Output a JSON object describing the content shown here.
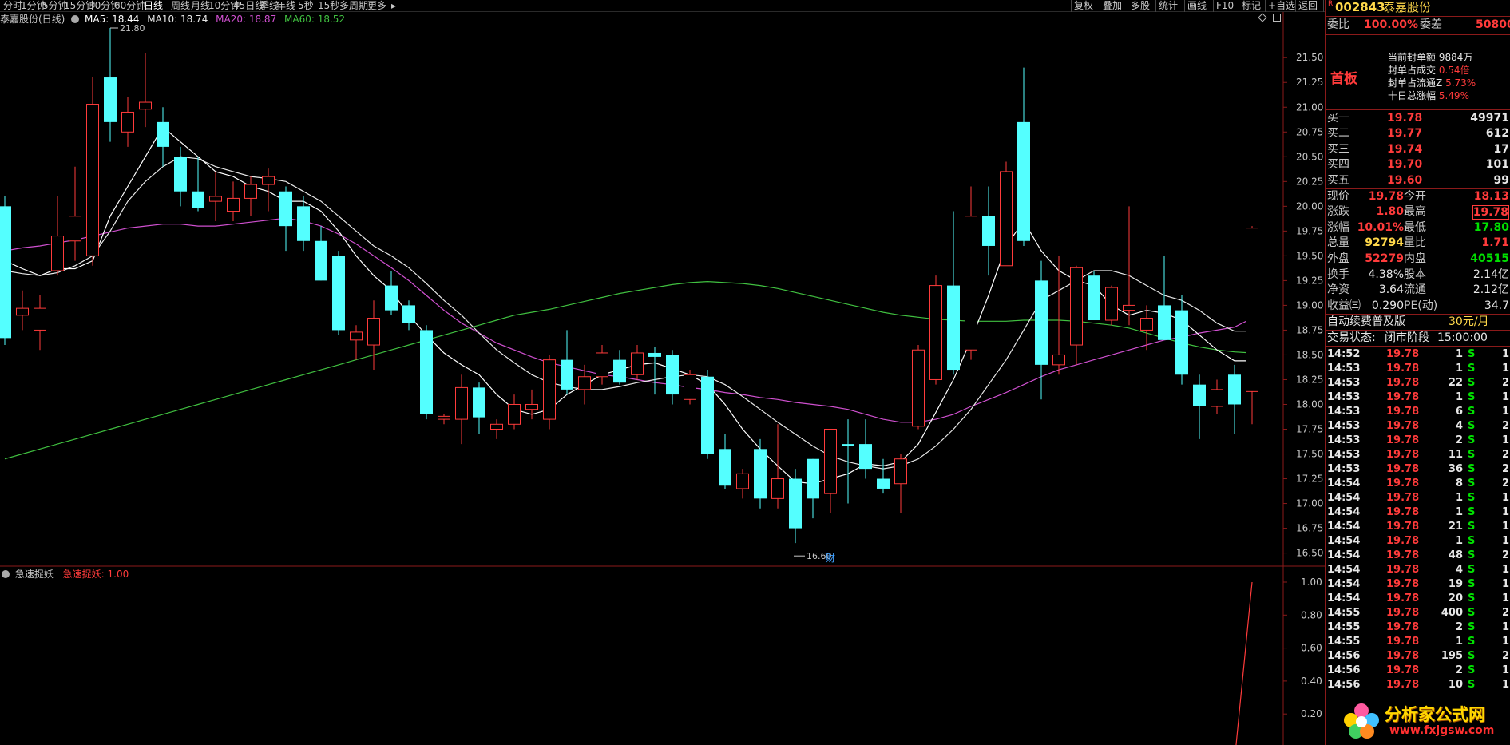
{
  "toolbar": {
    "periods": [
      "分时",
      "1分钟",
      "5分钟",
      "15分钟",
      "30分钟",
      "60分钟",
      "日线",
      "周线",
      "月线",
      "10分钟",
      "45日线",
      "季线",
      "年线",
      "5秒",
      "15秒",
      "多周期",
      "更多"
    ],
    "active_period": "日线",
    "right_buttons": [
      "复权",
      "叠加",
      "多股",
      "统计",
      "画线",
      "F10",
      "标记",
      "+自选",
      "返回"
    ]
  },
  "main_chart": {
    "title": "泰嘉股份(日线)",
    "ma": [
      {
        "label": "MA5: 18.44",
        "color": "#ffffff"
      },
      {
        "label": "MA10: 18.74",
        "color": "#e8e8e8"
      },
      {
        "label": "MA20: 18.87",
        "color": "#d050d0"
      },
      {
        "label": "MA60: 18.52",
        "color": "#40c040"
      }
    ],
    "high_label": "21.80",
    "low_label": "16.60",
    "event_marker": "财",
    "ylim": [
      16.4,
      21.8
    ],
    "yticks": [
      "21.50",
      "21.25",
      "21.00",
      "20.75",
      "20.50",
      "20.25",
      "20.00",
      "19.75",
      "19.50",
      "19.25",
      "19.00",
      "18.75",
      "18.50",
      "18.25",
      "18.00",
      "17.75",
      "17.50",
      "17.25",
      "17.00",
      "16.75",
      "16.50"
    ]
  },
  "chart_data": {
    "type": "candlestick",
    "up_color": "#ff3b3b",
    "down_color": "#54ffff",
    "ma_colors": {
      "MA5": "#ffffff",
      "MA10": "#e8e8e8",
      "MA20": "#d050d0",
      "MA60": "#40c040"
    },
    "candles": [
      {
        "o": 20.0,
        "h": 20.1,
        "l": 18.6,
        "c": 18.67
      },
      {
        "o": 18.9,
        "h": 19.15,
        "l": 18.75,
        "c": 18.97
      },
      {
        "o": 18.75,
        "h": 19.1,
        "l": 18.55,
        "c": 18.97
      },
      {
        "o": 19.35,
        "h": 20.1,
        "l": 19.3,
        "c": 19.7
      },
      {
        "o": 19.65,
        "h": 20.4,
        "l": 19.45,
        "c": 19.9
      },
      {
        "o": 19.5,
        "h": 21.3,
        "l": 19.4,
        "c": 21.03
      },
      {
        "o": 21.3,
        "h": 21.8,
        "l": 20.65,
        "c": 20.85
      },
      {
        "o": 20.75,
        "h": 21.1,
        "l": 20.6,
        "c": 20.95
      },
      {
        "o": 20.98,
        "h": 21.55,
        "l": 20.8,
        "c": 21.05
      },
      {
        "o": 20.85,
        "h": 21.0,
        "l": 20.4,
        "c": 20.6
      },
      {
        "o": 20.5,
        "h": 20.6,
        "l": 20.0,
        "c": 20.15
      },
      {
        "o": 20.15,
        "h": 20.5,
        "l": 19.95,
        "c": 19.98
      },
      {
        "o": 20.05,
        "h": 20.35,
        "l": 19.85,
        "c": 20.1
      },
      {
        "o": 19.95,
        "h": 20.25,
        "l": 19.85,
        "c": 20.08
      },
      {
        "o": 20.08,
        "h": 20.3,
        "l": 19.9,
        "c": 20.22
      },
      {
        "o": 20.22,
        "h": 20.38,
        "l": 19.95,
        "c": 20.3
      },
      {
        "o": 20.15,
        "h": 20.2,
        "l": 19.55,
        "c": 19.8
      },
      {
        "o": 20.0,
        "h": 20.1,
        "l": 19.55,
        "c": 19.65
      },
      {
        "o": 19.65,
        "h": 19.8,
        "l": 19.25,
        "c": 19.25
      },
      {
        "o": 19.5,
        "h": 19.55,
        "l": 18.7,
        "c": 18.75
      },
      {
        "o": 18.65,
        "h": 18.8,
        "l": 18.45,
        "c": 18.73
      },
      {
        "o": 18.6,
        "h": 19.05,
        "l": 18.35,
        "c": 18.87
      },
      {
        "o": 19.2,
        "h": 19.35,
        "l": 18.9,
        "c": 18.95
      },
      {
        "o": 19.0,
        "h": 19.05,
        "l": 18.75,
        "c": 18.82
      },
      {
        "o": 18.75,
        "h": 18.8,
        "l": 17.85,
        "c": 17.9
      },
      {
        "o": 17.85,
        "h": 17.9,
        "l": 17.8,
        "c": 17.88
      },
      {
        "o": 17.85,
        "h": 18.3,
        "l": 17.6,
        "c": 18.17
      },
      {
        "o": 18.17,
        "h": 18.22,
        "l": 17.7,
        "c": 17.87
      },
      {
        "o": 17.75,
        "h": 17.85,
        "l": 17.65,
        "c": 17.8
      },
      {
        "o": 17.8,
        "h": 18.1,
        "l": 17.75,
        "c": 18.0
      },
      {
        "o": 17.95,
        "h": 18.15,
        "l": 17.85,
        "c": 18.0
      },
      {
        "o": 17.85,
        "h": 18.5,
        "l": 17.75,
        "c": 18.45
      },
      {
        "o": 18.45,
        "h": 18.75,
        "l": 18.1,
        "c": 18.15
      },
      {
        "o": 18.15,
        "h": 18.4,
        "l": 18.0,
        "c": 18.28
      },
      {
        "o": 18.28,
        "h": 18.6,
        "l": 18.2,
        "c": 18.52
      },
      {
        "o": 18.45,
        "h": 18.55,
        "l": 18.2,
        "c": 18.22
      },
      {
        "o": 18.3,
        "h": 18.6,
        "l": 18.25,
        "c": 18.52
      },
      {
        "o": 18.52,
        "h": 18.58,
        "l": 18.1,
        "c": 18.48
      },
      {
        "o": 18.5,
        "h": 18.55,
        "l": 18.0,
        "c": 18.1
      },
      {
        "o": 18.05,
        "h": 18.35,
        "l": 18.0,
        "c": 18.3
      },
      {
        "o": 18.28,
        "h": 18.35,
        "l": 17.45,
        "c": 17.5
      },
      {
        "o": 17.55,
        "h": 17.7,
        "l": 17.15,
        "c": 17.18
      },
      {
        "o": 17.15,
        "h": 17.35,
        "l": 17.05,
        "c": 17.3
      },
      {
        "o": 17.55,
        "h": 17.65,
        "l": 16.95,
        "c": 17.05
      },
      {
        "o": 17.05,
        "h": 17.8,
        "l": 16.95,
        "c": 17.25
      },
      {
        "o": 17.25,
        "h": 17.35,
        "l": 16.6,
        "c": 16.75
      },
      {
        "o": 17.45,
        "h": 17.45,
        "l": 16.85,
        "c": 17.05
      },
      {
        "o": 17.1,
        "h": 17.75,
        "l": 16.9,
        "c": 17.75
      },
      {
        "o": 17.6,
        "h": 17.85,
        "l": 17.0,
        "c": 17.58
      },
      {
        "o": 17.6,
        "h": 17.85,
        "l": 17.25,
        "c": 17.35
      },
      {
        "o": 17.25,
        "h": 17.45,
        "l": 17.1,
        "c": 17.15
      },
      {
        "o": 17.2,
        "h": 17.5,
        "l": 16.9,
        "c": 17.45
      },
      {
        "o": 17.78,
        "h": 18.6,
        "l": 17.75,
        "c": 18.55
      },
      {
        "o": 18.25,
        "h": 19.3,
        "l": 18.2,
        "c": 19.2
      },
      {
        "o": 19.2,
        "h": 19.95,
        "l": 18.3,
        "c": 18.35
      },
      {
        "o": 18.55,
        "h": 20.2,
        "l": 18.45,
        "c": 19.9
      },
      {
        "o": 19.9,
        "h": 20.2,
        "l": 19.3,
        "c": 19.6
      },
      {
        "o": 19.4,
        "h": 20.45,
        "l": 19.4,
        "c": 20.35
      },
      {
        "o": 20.85,
        "h": 21.4,
        "l": 19.6,
        "c": 19.65
      },
      {
        "o": 19.25,
        "h": 19.45,
        "l": 18.05,
        "c": 18.4
      },
      {
        "o": 18.4,
        "h": 19.5,
        "l": 18.3,
        "c": 18.5
      },
      {
        "o": 18.6,
        "h": 19.4,
        "l": 18.4,
        "c": 19.38
      },
      {
        "o": 19.3,
        "h": 19.35,
        "l": 18.85,
        "c": 18.85
      },
      {
        "o": 18.85,
        "h": 19.2,
        "l": 18.8,
        "c": 19.18
      },
      {
        "o": 18.95,
        "h": 20.0,
        "l": 18.8,
        "c": 19.0
      },
      {
        "o": 18.75,
        "h": 19.0,
        "l": 18.55,
        "c": 18.87
      },
      {
        "o": 19.0,
        "h": 19.5,
        "l": 18.65,
        "c": 18.65
      },
      {
        "o": 18.95,
        "h": 19.1,
        "l": 18.2,
        "c": 18.3
      },
      {
        "o": 18.2,
        "h": 18.3,
        "l": 17.65,
        "c": 17.98
      },
      {
        "o": 17.98,
        "h": 18.25,
        "l": 17.9,
        "c": 18.15
      },
      {
        "o": 18.3,
        "h": 18.4,
        "l": 17.7,
        "c": 18.0
      },
      {
        "o": 18.13,
        "h": 19.8,
        "l": 17.8,
        "c": 19.78
      }
    ],
    "ma5": [
      19.45,
      19.37,
      19.3,
      19.37,
      19.37,
      19.45,
      19.9,
      20.2,
      20.5,
      20.8,
      20.65,
      20.5,
      20.35,
      20.3,
      20.2,
      20.15,
      20.05,
      20.05,
      19.95,
      19.75,
      19.5,
      19.3,
      19.15,
      18.9,
      18.7,
      18.52,
      18.4,
      18.3,
      18.1,
      17.95,
      17.9,
      17.95,
      18.1,
      18.2,
      18.3,
      18.35,
      18.4,
      18.42,
      18.36,
      18.3,
      18.2,
      18.0,
      17.75,
      17.55,
      17.38,
      17.22,
      17.2,
      17.25,
      17.3,
      17.4,
      17.38,
      17.42,
      17.6,
      17.92,
      18.25,
      18.65,
      19.1,
      19.6,
      19.85,
      19.55,
      19.35,
      19.25,
      19.2,
      19.0,
      18.9,
      18.95,
      18.92,
      18.85,
      18.7,
      18.55,
      18.44,
      18.44
    ],
    "ma10": [
      19.35,
      19.32,
      19.3,
      19.33,
      19.4,
      19.5,
      19.75,
      20.05,
      20.25,
      20.4,
      20.5,
      20.48,
      20.4,
      20.35,
      20.3,
      20.28,
      20.25,
      20.15,
      20.05,
      19.9,
      19.75,
      19.6,
      19.5,
      19.38,
      19.22,
      19.05,
      18.9,
      18.72,
      18.55,
      18.42,
      18.3,
      18.22,
      18.18,
      18.15,
      18.15,
      18.18,
      18.22,
      18.25,
      18.28,
      18.3,
      18.28,
      18.2,
      18.08,
      17.95,
      17.82,
      17.7,
      17.58,
      17.48,
      17.42,
      17.38,
      17.35,
      17.38,
      17.45,
      17.58,
      17.75,
      17.95,
      18.2,
      18.45,
      18.75,
      19.05,
      19.15,
      19.25,
      19.35,
      19.35,
      19.3,
      19.2,
      19.1,
      19.05,
      18.95,
      18.82,
      18.74,
      18.74
    ],
    "ma20": [
      19.55,
      19.58,
      19.6,
      19.63,
      19.66,
      19.7,
      19.74,
      19.78,
      19.8,
      19.82,
      19.82,
      19.8,
      19.8,
      19.82,
      19.84,
      19.86,
      19.88,
      19.85,
      19.8,
      19.72,
      19.62,
      19.5,
      19.38,
      19.25,
      19.1,
      18.95,
      18.82,
      18.72,
      18.62,
      18.55,
      18.48,
      18.42,
      18.38,
      18.34,
      18.3,
      18.28,
      18.25,
      18.22,
      18.2,
      18.17,
      18.15,
      18.12,
      18.1,
      18.07,
      18.05,
      18.02,
      18.0,
      17.98,
      17.95,
      17.9,
      17.85,
      17.82,
      17.82,
      17.85,
      17.9,
      17.98,
      18.05,
      18.12,
      18.2,
      18.28,
      18.35,
      18.4,
      18.45,
      18.5,
      18.55,
      18.6,
      18.65,
      18.68,
      18.72,
      18.75,
      18.78,
      18.87
    ],
    "ma60": [
      17.45,
      17.5,
      17.55,
      17.6,
      17.65,
      17.7,
      17.75,
      17.8,
      17.85,
      17.9,
      17.95,
      18.0,
      18.05,
      18.1,
      18.15,
      18.2,
      18.25,
      18.3,
      18.35,
      18.4,
      18.45,
      18.5,
      18.55,
      18.6,
      18.65,
      18.7,
      18.75,
      18.8,
      18.85,
      18.9,
      18.93,
      18.96,
      19.0,
      19.04,
      19.08,
      19.12,
      19.15,
      19.18,
      19.21,
      19.23,
      19.24,
      19.23,
      19.22,
      19.2,
      19.17,
      19.13,
      19.09,
      19.05,
      19.01,
      18.97,
      18.93,
      18.9,
      18.88,
      18.86,
      18.85,
      18.84,
      18.84,
      18.84,
      18.85,
      18.85,
      18.85,
      18.84,
      18.82,
      18.8,
      18.77,
      18.72,
      18.67,
      18.62,
      18.58,
      18.55,
      18.53,
      18.52
    ]
  },
  "indicator": {
    "name": "急速捉妖",
    "value_label": "急速捉妖: 1.00",
    "yticks": [
      "1.00",
      "0.80",
      "0.60",
      "0.40",
      "0.20"
    ],
    "values": [
      0,
      0,
      0,
      0,
      0,
      0,
      0,
      0,
      0,
      0,
      0,
      0,
      0,
      0,
      0,
      0,
      0,
      0,
      0,
      0,
      0,
      0,
      0,
      0,
      0,
      0,
      0,
      0,
      0,
      0,
      0,
      0,
      0,
      0,
      0,
      0,
      0,
      0,
      0,
      0,
      0,
      0,
      0,
      0,
      0,
      0,
      0,
      0,
      0,
      0,
      0,
      0,
      0,
      0,
      0,
      0,
      0,
      0,
      0,
      0,
      0,
      0,
      0,
      0,
      0,
      0,
      0,
      0,
      0,
      0,
      0,
      1.0
    ]
  },
  "quote": {
    "code": "002843",
    "name": "泰嘉股份",
    "weibi_label": "委比",
    "weibi_value": "100.00%",
    "weicha_label": "委差",
    "weicha_value": "50800",
    "board_label": "首板",
    "seal_items": [
      {
        "label": "当前封单额",
        "value": "9884万"
      },
      {
        "label": "封单占成交",
        "value": "0.54倍"
      },
      {
        "label": "封单占流通Z",
        "value": "5.73%"
      },
      {
        "label": "十日总涨幅",
        "value": "5.49%"
      }
    ],
    "bids": [
      {
        "label": "买一",
        "price": "19.78",
        "vol": "49971"
      },
      {
        "label": "买二",
        "price": "19.77",
        "vol": "612"
      },
      {
        "label": "买三",
        "price": "19.74",
        "vol": "17"
      },
      {
        "label": "买四",
        "price": "19.70",
        "vol": "101"
      },
      {
        "label": "买五",
        "price": "19.60",
        "vol": "99"
      }
    ],
    "stats": [
      {
        "l1": "现价",
        "v1": "19.78",
        "c1": "red",
        "l2": "今开",
        "v2": "18.13",
        "c2": "red"
      },
      {
        "l1": "涨跌",
        "v1": "1.80",
        "c1": "red",
        "l2": "最高",
        "v2": "19.78",
        "c2": "red"
      },
      {
        "l1": "涨幅",
        "v1": "10.01%",
        "c1": "red",
        "l2": "最低",
        "v2": "17.80",
        "c2": "grn"
      },
      {
        "l1": "总量",
        "v1": "92794",
        "c1": "yel",
        "l2": "量比",
        "v2": "1.71",
        "c2": "red"
      },
      {
        "l1": "外盘",
        "v1": "52279",
        "c1": "red",
        "l2": "内盘",
        "v2": "40515",
        "c2": "grn"
      }
    ],
    "stats2": [
      {
        "l1": "换手",
        "v1": "4.38%",
        "l2": "股本",
        "v2": "2.14亿"
      },
      {
        "l1": "净资",
        "v1": "3.64",
        "l2": "流通",
        "v2": "2.12亿"
      },
      {
        "l1": "收益㈢",
        "v1": "0.290",
        "l2": "PE(动)",
        "v2": "34.7"
      }
    ],
    "promo": "自动续费普及版",
    "promo_price": "30元/月",
    "trade_status_label": "交易状态:",
    "trade_status": "闭市阶段",
    "trade_time": "15:00:00",
    "ticks": [
      {
        "t": "14:52",
        "p": "19.78",
        "v": "1",
        "s": "S",
        "n": "1"
      },
      {
        "t": "14:53",
        "p": "19.78",
        "v": "1",
        "s": "S",
        "n": "1"
      },
      {
        "t": "14:53",
        "p": "19.78",
        "v": "22",
        "s": "S",
        "n": "2"
      },
      {
        "t": "14:53",
        "p": "19.78",
        "v": "1",
        "s": "S",
        "n": "1"
      },
      {
        "t": "14:53",
        "p": "19.78",
        "v": "6",
        "s": "S",
        "n": "1"
      },
      {
        "t": "14:53",
        "p": "19.78",
        "v": "4",
        "s": "S",
        "n": "2"
      },
      {
        "t": "14:53",
        "p": "19.78",
        "v": "2",
        "s": "S",
        "n": "1"
      },
      {
        "t": "14:53",
        "p": "19.78",
        "v": "11",
        "s": "S",
        "n": "2"
      },
      {
        "t": "14:53",
        "p": "19.78",
        "v": "36",
        "s": "S",
        "n": "2"
      },
      {
        "t": "14:54",
        "p": "19.78",
        "v": "8",
        "s": "S",
        "n": "2"
      },
      {
        "t": "14:54",
        "p": "19.78",
        "v": "1",
        "s": "S",
        "n": "1"
      },
      {
        "t": "14:54",
        "p": "19.78",
        "v": "1",
        "s": "S",
        "n": "1"
      },
      {
        "t": "14:54",
        "p": "19.78",
        "v": "21",
        "s": "S",
        "n": "1"
      },
      {
        "t": "14:54",
        "p": "19.78",
        "v": "1",
        "s": "S",
        "n": "1"
      },
      {
        "t": "14:54",
        "p": "19.78",
        "v": "48",
        "s": "S",
        "n": "2"
      },
      {
        "t": "14:54",
        "p": "19.78",
        "v": "4",
        "s": "S",
        "n": "1"
      },
      {
        "t": "14:54",
        "p": "19.78",
        "v": "19",
        "s": "S",
        "n": "1"
      },
      {
        "t": "14:54",
        "p": "19.78",
        "v": "20",
        "s": "S",
        "n": "1"
      },
      {
        "t": "14:55",
        "p": "19.78",
        "v": "400",
        "s": "S",
        "n": "2"
      },
      {
        "t": "14:55",
        "p": "19.78",
        "v": "2",
        "s": "S",
        "n": "1"
      },
      {
        "t": "14:55",
        "p": "19.78",
        "v": "1",
        "s": "S",
        "n": "1"
      },
      {
        "t": "14:56",
        "p": "19.78",
        "v": "195",
        "s": "S",
        "n": "2"
      },
      {
        "t": "14:56",
        "p": "19.78",
        "v": "2",
        "s": "S",
        "n": "1"
      },
      {
        "t": "14:56",
        "p": "19.78",
        "v": "10",
        "s": "S",
        "n": "1"
      }
    ]
  },
  "watermark": {
    "text": "分析家公式网",
    "url": "www.fxjgsw.com"
  }
}
